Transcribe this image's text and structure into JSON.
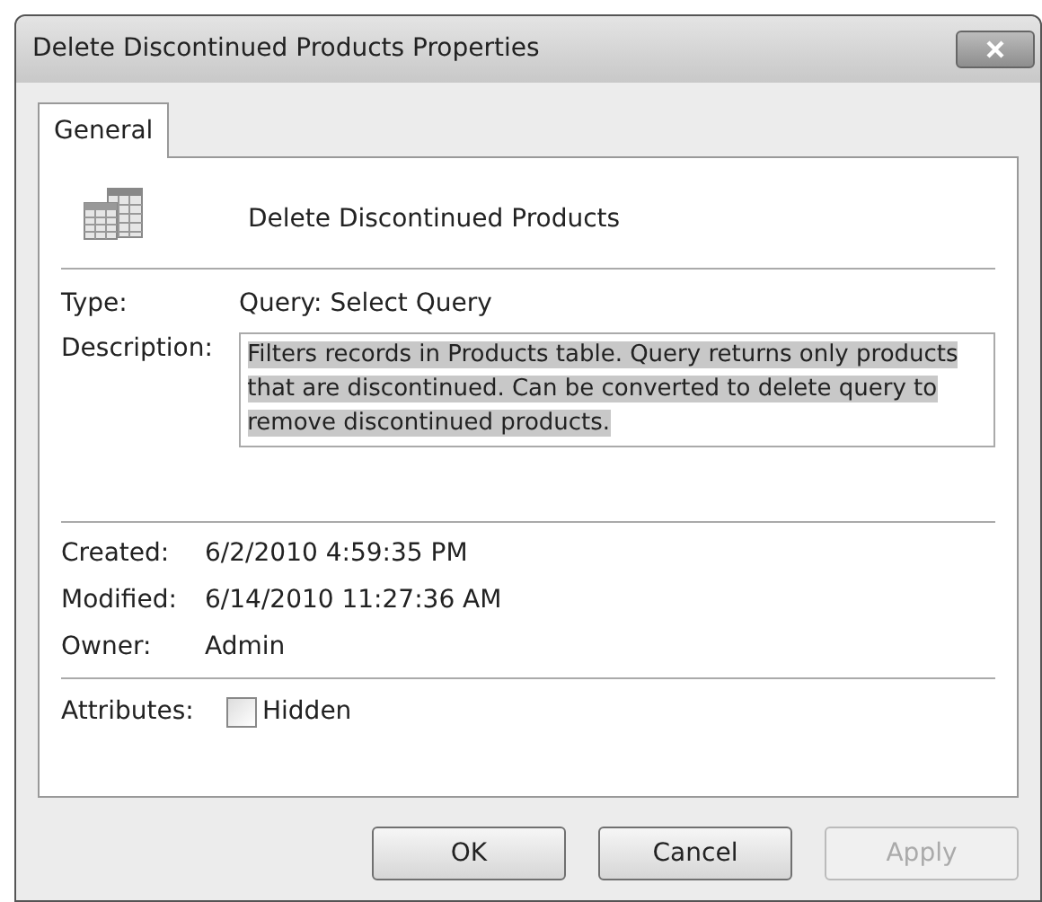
{
  "window": {
    "title": "Delete Discontinued Products Properties"
  },
  "tabs": [
    {
      "label": "General",
      "selected": true
    }
  ],
  "object_name": "Delete Discontinued Products",
  "type": {
    "label": "Type:",
    "value": "Query: Select Query"
  },
  "description": {
    "label": "Description:",
    "value": "Filters records in Products table. Query returns only products that are discontinued. Can be converted to delete query to remove discontinued products.",
    "text_selected": true
  },
  "details": [
    {
      "label": "Created:",
      "value": "6/2/2010 4:59:35 PM"
    },
    {
      "label": "Modified:",
      "value": "6/14/2010 11:27:36 AM"
    },
    {
      "label": "Owner:",
      "value": "Admin"
    }
  ],
  "attributes": {
    "label": "Attributes:",
    "options": [
      {
        "label": "Hidden",
        "checked": false
      }
    ]
  },
  "buttons": [
    {
      "label": "OK",
      "disabled": false
    },
    {
      "label": "Cancel",
      "disabled": false
    },
    {
      "label": "Apply",
      "disabled": true
    }
  ]
}
